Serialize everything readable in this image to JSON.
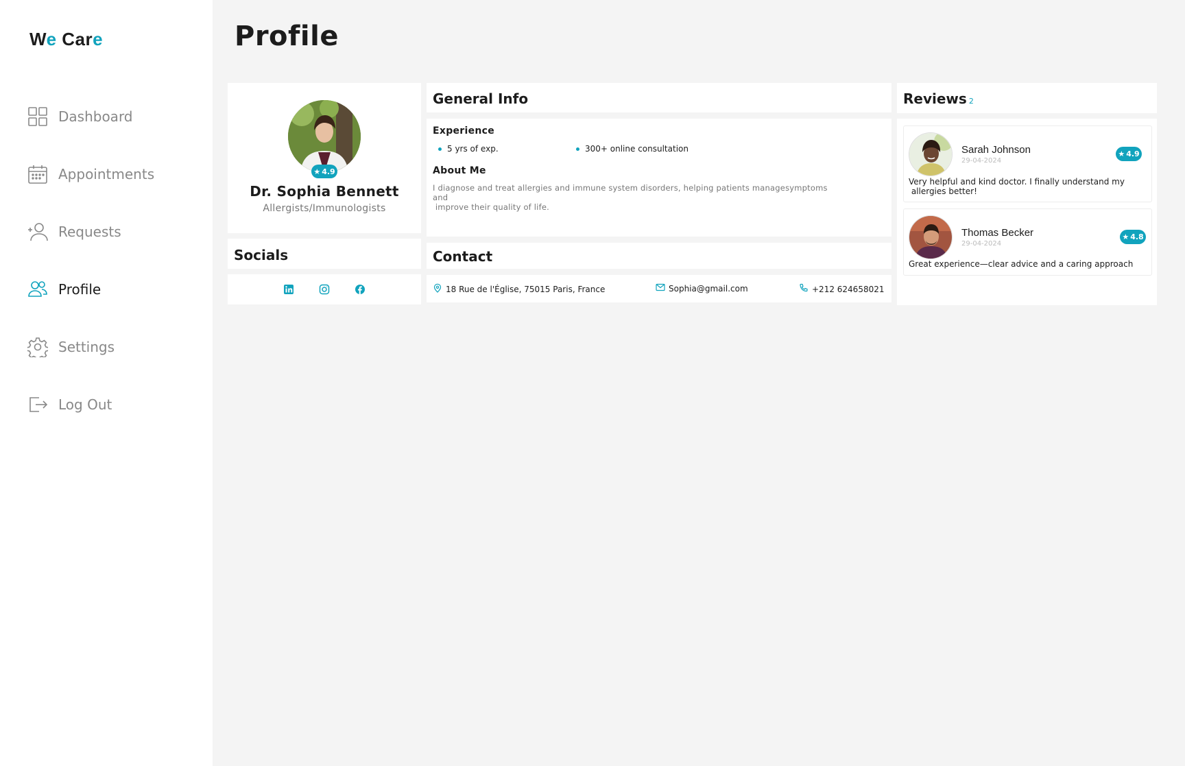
{
  "app": {
    "logo_part1": "W",
    "logo_part2": "e",
    "logo_part3": " Car",
    "logo_part4": "e",
    "accent_color": "#11a3bd"
  },
  "sidebar": {
    "items": [
      {
        "label": "Dashboard",
        "icon": "grid-icon",
        "active": false
      },
      {
        "label": "Appointments",
        "icon": "calendar-icon",
        "active": false
      },
      {
        "label": "Requests",
        "icon": "add-user-icon",
        "active": false
      },
      {
        "label": "Profile",
        "icon": "users-icon",
        "active": true
      },
      {
        "label": "Settings",
        "icon": "gear-icon",
        "active": false
      },
      {
        "label": "Log Out",
        "icon": "logout-icon",
        "active": false
      }
    ]
  },
  "page": {
    "title": "Profile"
  },
  "profile": {
    "name": "Dr. Sophia Bennett",
    "specialty": "Allergists/Immunologists",
    "rating": "4.9"
  },
  "socials": {
    "title": "Socials",
    "icons": [
      "linkedin-icon",
      "instagram-icon",
      "facebook-icon"
    ]
  },
  "general_info": {
    "title": "General Info",
    "experience_title": "Experience",
    "experience": [
      "5 yrs of exp.",
      "300+ online consultation"
    ],
    "about_title": "About Me",
    "about_line1": "I diagnose and treat allergies and immune system disorders, helping patients managesymptoms and",
    "about_line2": " improve their quality of life."
  },
  "contact": {
    "title": "Contact",
    "address": "18 Rue de l'Église, 75015 Paris, France",
    "email": "Sophia@gmail.com",
    "phone": "+212 624658021"
  },
  "reviews": {
    "title": "Reviews",
    "count": "2",
    "items": [
      {
        "name": "Sarah Johnson",
        "date": "29-04-2024",
        "rating": "4.9",
        "text_line1": "Very helpful and kind doctor. I finally understand my",
        "text_line2": " allergies better!"
      },
      {
        "name": "Thomas Becker",
        "date": "29-04-2024",
        "rating": "4.8",
        "text_line1": "Great experience—clear advice and a caring approach",
        "text_line2": ""
      }
    ]
  }
}
